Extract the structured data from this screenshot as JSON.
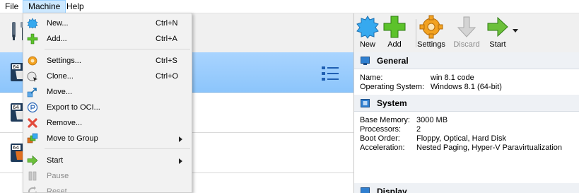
{
  "menubar": {
    "file": "File",
    "machine": "Machine",
    "help": "Help"
  },
  "toolbar": {
    "new_label": "New",
    "add_label": "Add",
    "settings_label": "Settings",
    "discard_label": "Discard",
    "start_label": "Start"
  },
  "machine_menu": {
    "new": {
      "label": "New...",
      "shortcut": "Ctrl+N"
    },
    "add": {
      "label": "Add...",
      "shortcut": "Ctrl+A"
    },
    "settings": {
      "label": "Settings...",
      "shortcut": "Ctrl+S"
    },
    "clone": {
      "label": "Clone...",
      "shortcut": "Ctrl+O"
    },
    "move": {
      "label": "Move..."
    },
    "export_oci": {
      "label": "Export to OCI..."
    },
    "remove": {
      "label": "Remove..."
    },
    "move_to_group": {
      "label": "Move to Group"
    },
    "start": {
      "label": "Start"
    },
    "pause": {
      "label": "Pause"
    },
    "reset": {
      "label": "Reset"
    }
  },
  "details": {
    "general": {
      "title": "General",
      "name_key": "Name:",
      "name_value": "win 8.1 code",
      "os_key": "Operating System:",
      "os_value": "Windows 8.1 (64-bit)"
    },
    "system": {
      "title": "System",
      "memory_key": "Base Memory:",
      "memory_value": "3000 MB",
      "processors_key": "Processors:",
      "processors_value": "2",
      "boot_key": "Boot Order:",
      "boot_value": "Floppy, Optical, Hard Disk",
      "accel_key": "Acceleration:",
      "accel_value": "Nested Paging, Hyper-V Paravirtualization"
    },
    "display": {
      "title": "Display"
    }
  },
  "colors": {
    "menu_open_bg": "#cce8ff",
    "selection": "#99ccff",
    "menu_bg": "#f2f2f2"
  }
}
